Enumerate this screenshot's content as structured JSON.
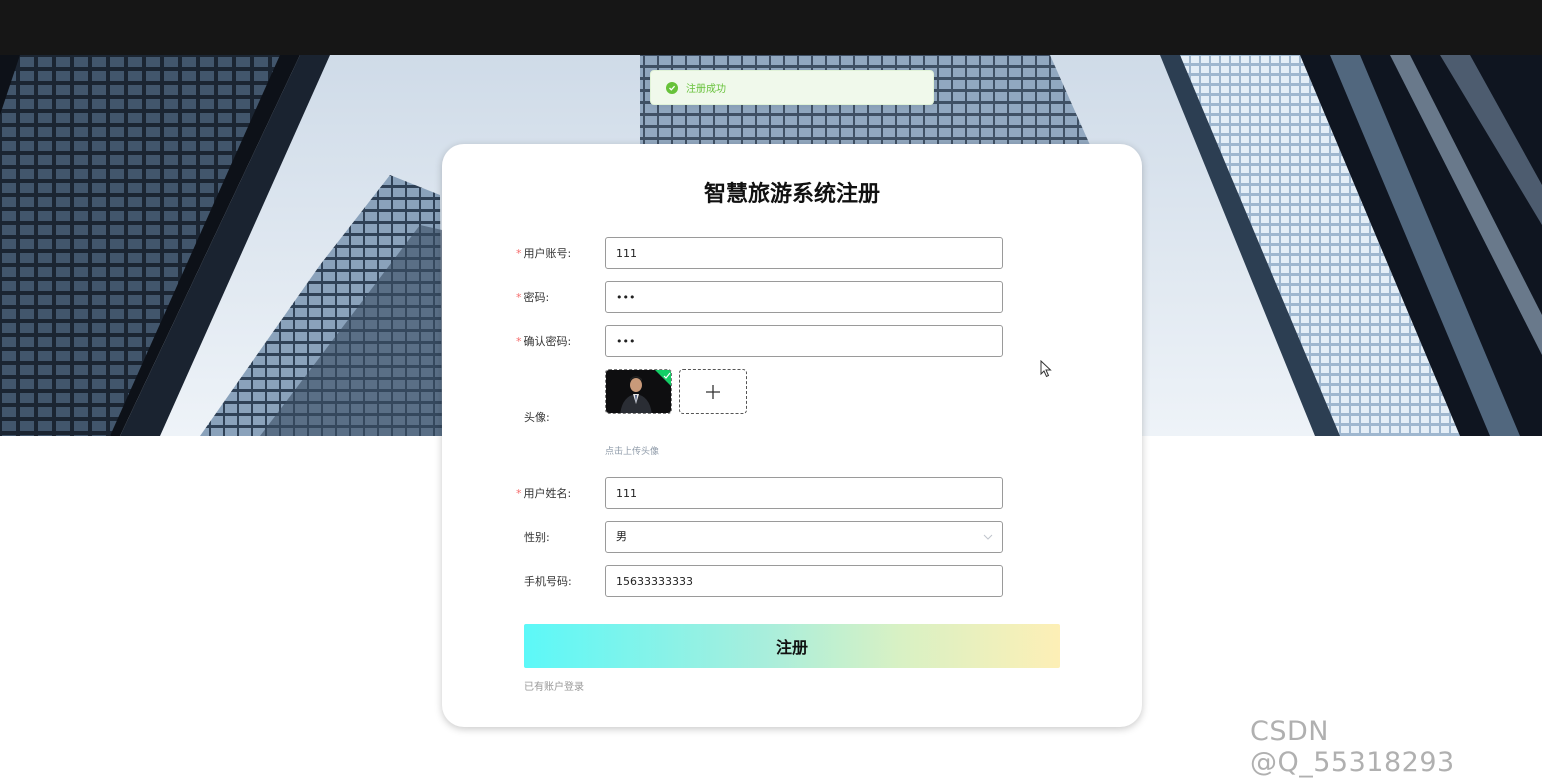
{
  "toast": {
    "message": "注册成功",
    "icon": "check-circle-icon",
    "color": "#67c23a"
  },
  "form": {
    "title": "智慧旅游系统注册",
    "fields": {
      "account": {
        "label": "用户账号:",
        "required": true,
        "value": "111"
      },
      "password": {
        "label": "密码:",
        "required": true,
        "value": "•••"
      },
      "confirm_password": {
        "label": "确认密码:",
        "required": true,
        "value": "•••"
      },
      "avatar": {
        "label": "头像:",
        "hint": "点击上传头像",
        "upload_icon": "plus-icon"
      },
      "name": {
        "label": "用户姓名:",
        "required": true,
        "value": "111"
      },
      "gender": {
        "label": "性别:",
        "value": "男"
      },
      "phone": {
        "label": "手机号码:",
        "value": "15633333333"
      }
    },
    "required_mark": "*",
    "submit_label": "注册",
    "login_link": "已有账户登录"
  },
  "watermark": "CSDN @Q_55318293",
  "colors": {
    "topbar": "#161616",
    "required": "#f56c6c",
    "button_gradient": [
      "#5cf8f8",
      "#fdefb6"
    ]
  }
}
